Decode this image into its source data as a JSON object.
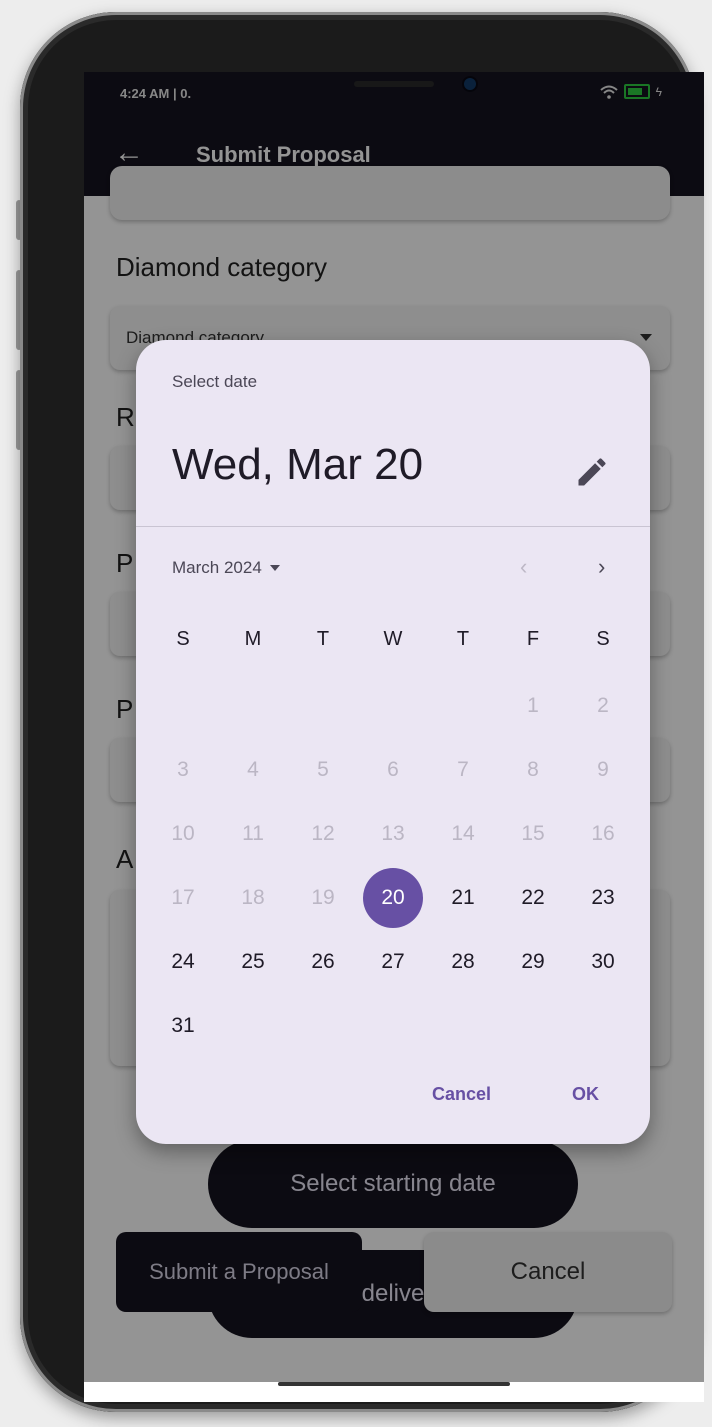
{
  "status": {
    "time": "4:24 AM | 0."
  },
  "app_bar": {
    "title": "Submit Proposal"
  },
  "form": {
    "diamond_category_label": "Diamond category",
    "diamond_category_value": "Diamond category",
    "label_r": "R",
    "label_p1": "P",
    "label_p2": "P",
    "label_a": "A",
    "starting_date_button": "Select starting date",
    "delivery_date_button": "Select delivery date",
    "submit_button": "Submit a Proposal",
    "cancel_button": "Cancel"
  },
  "date_picker": {
    "headline": "Select date",
    "selected_date": "Wed, Mar 20",
    "month_label": "March 2024",
    "weekdays": [
      "S",
      "M",
      "T",
      "W",
      "T",
      "F",
      "S"
    ],
    "leading_blanks": 5,
    "days": [
      "1",
      "2",
      "3",
      "4",
      "5",
      "6",
      "7",
      "8",
      "9",
      "10",
      "11",
      "12",
      "13",
      "14",
      "15",
      "16",
      "17",
      "18",
      "19",
      "20",
      "21",
      "22",
      "23",
      "24",
      "25",
      "26",
      "27",
      "28",
      "29",
      "30",
      "31"
    ],
    "first_enabled_day": 20,
    "selected_day": 20,
    "cancel_label": "Cancel",
    "ok_label": "OK",
    "accent_color": "#6750a4"
  },
  "icons": {
    "back": "arrow-left-icon",
    "edit": "pencil-icon",
    "prev": "chevron-left-icon",
    "next": "chevron-right-icon"
  }
}
